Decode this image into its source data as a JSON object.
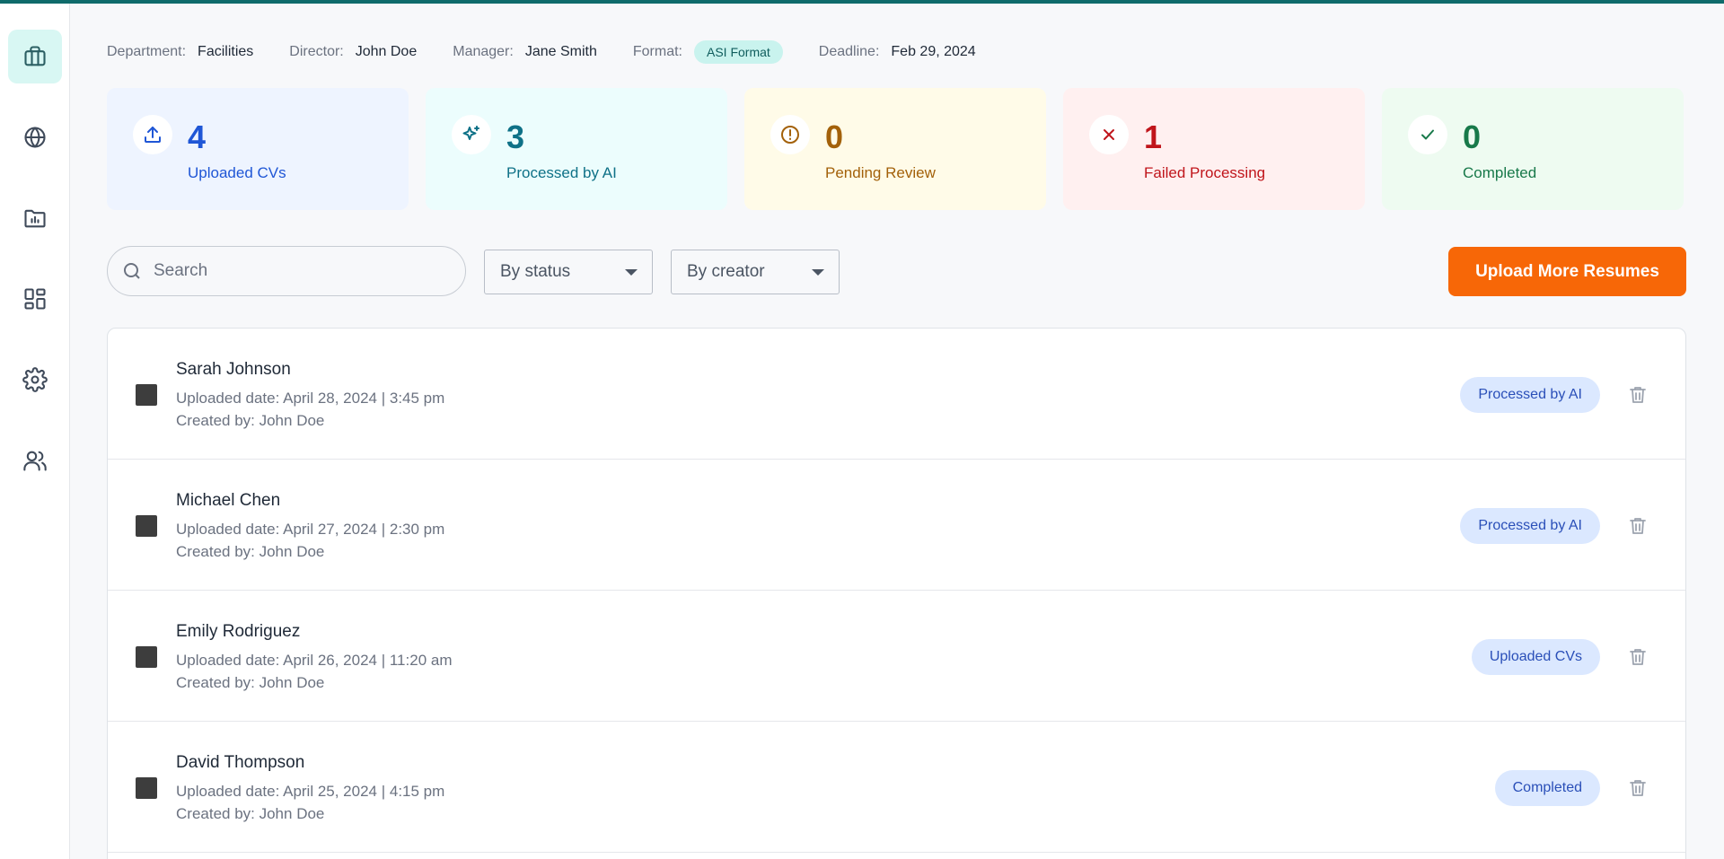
{
  "meta": {
    "department_label": "Department:",
    "department": "Facilities",
    "director_label": "Director:",
    "director": "John Doe",
    "manager_label": "Manager:",
    "manager": "Jane Smith",
    "format_label": "Format:",
    "format": "ASI Format",
    "deadline_label": "Deadline:",
    "deadline": "Feb 29, 2024"
  },
  "sidebar": {
    "items": [
      {
        "icon": "briefcase-icon",
        "active": true
      },
      {
        "icon": "globe-icon",
        "active": false
      },
      {
        "icon": "folder-chart-icon",
        "active": false
      },
      {
        "icon": "dashboard-icon",
        "active": false
      },
      {
        "icon": "gear-icon",
        "active": false
      },
      {
        "icon": "users-icon",
        "active": false
      }
    ]
  },
  "stats": [
    {
      "count": "4",
      "label": "Uploaded CVs",
      "icon": "upload-icon",
      "color": "#1f56d6"
    },
    {
      "count": "3",
      "label": "Processed by AI",
      "icon": "sparkle-icon",
      "color": "#0e7187"
    },
    {
      "count": "0",
      "label": "Pending Review",
      "icon": "alert-circle-icon",
      "color": "#a3610a"
    },
    {
      "count": "1",
      "label": "Failed Processing",
      "icon": "x-icon",
      "color": "#c0151b"
    },
    {
      "count": "0",
      "label": "Completed",
      "icon": "check-icon",
      "color": "#18794a"
    }
  ],
  "filters": {
    "search_placeholder": "Search",
    "status_select": "By status",
    "creator_select": "By creator"
  },
  "upload_button": "Upload More Resumes",
  "rows": [
    {
      "name": "Sarah Johnson",
      "date": "Uploaded date: April 28, 2024 | 3:45 pm",
      "creator": "Created by: John Doe",
      "status": "Processed by AI"
    },
    {
      "name": "Michael Chen",
      "date": "Uploaded date: April 27, 2024 | 2:30 pm",
      "creator": "Created by: John Doe",
      "status": "Processed by AI"
    },
    {
      "name": "Emily Rodriguez",
      "date": "Uploaded date: April 26, 2024 | 11:20 am",
      "creator": "Created by: John Doe",
      "status": "Uploaded CVs"
    },
    {
      "name": "David Thompson",
      "date": "Uploaded date: April 25, 2024 | 4:15 pm",
      "creator": "Created by: John Doe",
      "status": "Completed"
    }
  ],
  "colors": {
    "accent": "#0f6b6b",
    "upload_button": "#f76707",
    "active_nav": "#d8f7f3"
  }
}
